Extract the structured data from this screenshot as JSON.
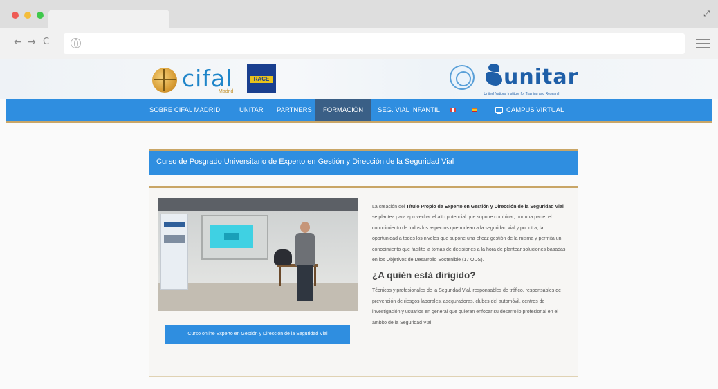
{
  "browser": {
    "nav": {
      "back": "←",
      "forward": "→",
      "reload": "C"
    }
  },
  "header": {
    "cifal_name": "cifal",
    "cifal_city": "Madrid",
    "race_label": "RACE",
    "unitar_name": "unitar",
    "unitar_subtitle": "United Nations Institute for Training and Research"
  },
  "nav": {
    "items": [
      "SOBRE CIFAL MADRID",
      "UNITAR",
      "PARTNERS",
      "FORMACIÓN",
      "SEG. VIAL INFANTIL"
    ],
    "active": "FORMACIÓN",
    "campus": "CAMPUS VIRTUAL"
  },
  "page": {
    "title": "Curso de Posgrado Universitario de Experto en Gestión y Dirección de la Seguridad Vial",
    "button": "Curso online Experto en Gestión y Dirección de la Seguridad Vial",
    "intro_pre": "La creación del ",
    "intro_bold": "Título Propio de Experto en Gestión y Dirección de la Seguridad Vial",
    "intro_post": " se plantea para aprovechar el alto potencial que supone combinar, por una parte, el conocimiento de todos los aspectos que rodean a la seguridad vial y por otra, la oportunidad a todos los niveles que supone una eficaz gestión de la misma y permita un conocimiento que facilite la tomas de decisiones a la hora de plantear soluciones basadas en los Objetivos de Desarrollo Sostenible (17 ODS).",
    "heading": "¿A quién está dirigido?",
    "audience": "Técnicos y profesionales de la Seguridad Vial, responsables de tráfico, responsables de prevención de riesgos laborales, aseguradoras, clubes del automóvil, centros de investigación y usuarios en general que quieran enfocar su desarrollo profesional en el ámbito de la Seguridad Vial."
  },
  "colors": {
    "nav_blue": "#2f8ee0",
    "nav_active": "#3a5f86",
    "gold_accent": "#c9a667"
  }
}
